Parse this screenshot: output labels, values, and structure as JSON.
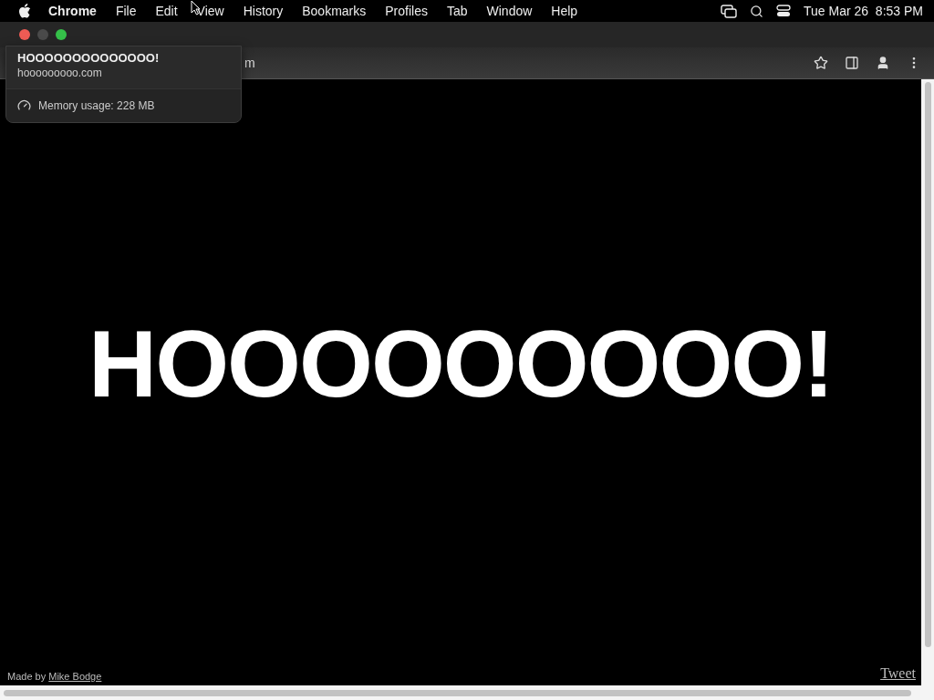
{
  "menu_bar": {
    "app": "Chrome",
    "items": [
      "File",
      "Edit",
      "View",
      "History",
      "Bookmarks",
      "Profiles",
      "Tab",
      "Window",
      "Help"
    ],
    "clock": "Tue Mar 26  8:53 PM"
  },
  "toolbar": {
    "address_visible": "m"
  },
  "tab_hover_card": {
    "title": "HOOOOOOOOOOOOOO!",
    "domain": "hooooooooo.com",
    "memory": "Memory usage: 228 MB"
  },
  "page": {
    "headline": "HOOOOOOOOO!",
    "credit_prefix": "Made by",
    "credit_link": "Mike Bodge",
    "tweet": "Tweet"
  }
}
